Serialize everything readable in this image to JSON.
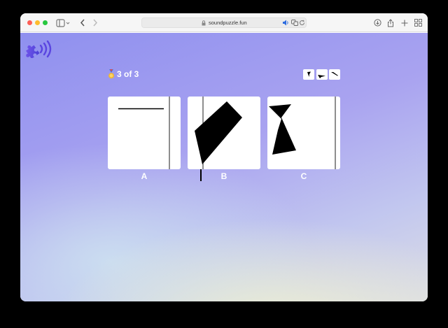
{
  "browser": {
    "url": "soundpuzzle.fun",
    "traffic_lights": [
      "close",
      "minimize",
      "zoom"
    ],
    "icons": [
      "sidebar-icon",
      "back-icon",
      "forward-icon",
      "lock-icon",
      "speaker-icon",
      "translate-icon",
      "reload-icon",
      "download-icon",
      "share-icon",
      "new-tab-icon",
      "tab-overview-icon"
    ]
  },
  "app": {
    "logo_icon": "puzzle-sound-logo",
    "progress": {
      "medal_icon": "medal-icon",
      "text": "3 of 3",
      "current": 3,
      "total": 3
    },
    "clue_icons": [
      "shape-clue-1",
      "shape-clue-2",
      "shape-clue-3"
    ],
    "options": [
      {
        "label": "A"
      },
      {
        "label": "B"
      },
      {
        "label": "C"
      }
    ]
  },
  "colors": {
    "accent_purple": "#6b5ce7",
    "background_top": "#8f90ef",
    "background_bottom": "#eef0d2",
    "card": "#ffffff",
    "shape": "#000000"
  }
}
